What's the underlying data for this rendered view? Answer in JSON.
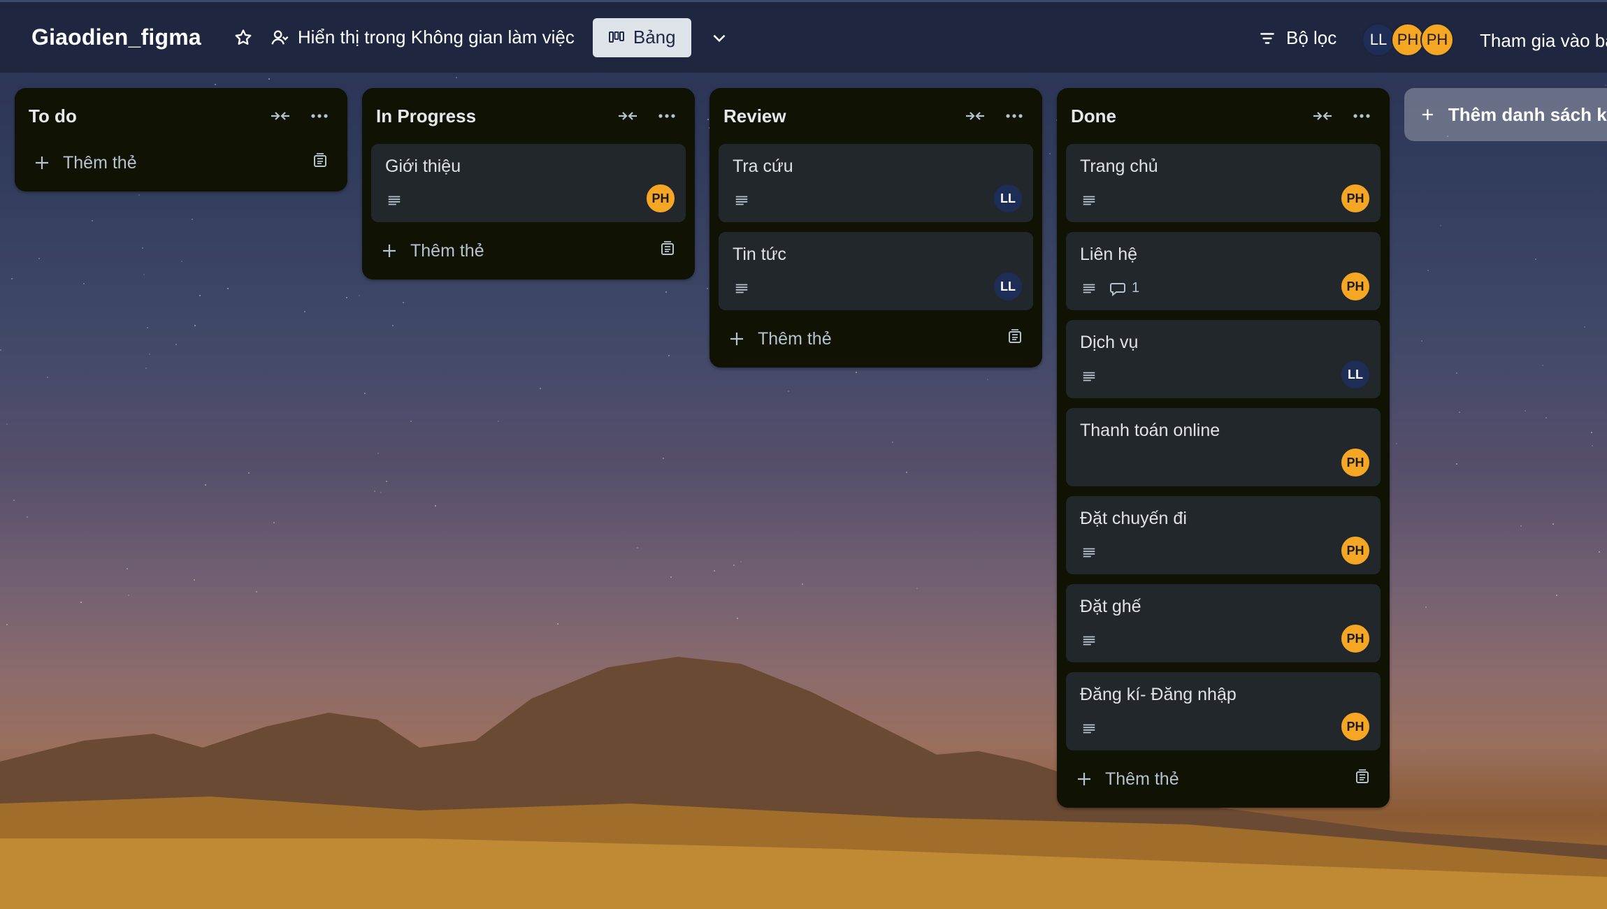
{
  "board": {
    "title": "Giaodien_figma",
    "visibility_label": "Hiển thị trong Không gian làm việc",
    "view_label": "Bảng",
    "filter_label": "Bộ lọc",
    "join_label": "Tham gia vào bả",
    "members": [
      "LL",
      "PH",
      "PH"
    ]
  },
  "colors": {
    "list_bg": "#101204",
    "card_bg": "#22272b",
    "avatar_ph": "#f5a623",
    "avatar_ll": "#1d2d55"
  },
  "icons": {
    "star": "star-icon",
    "visibility": "people-icon",
    "view": "board-icon",
    "chevron": "chevron-down-icon",
    "filter": "filter-icon",
    "collapse": "collapse-arrows-icon",
    "more": "more-dots-icon",
    "description": "description-lines-icon",
    "comment": "comment-icon",
    "template": "template-icon",
    "plus": "plus-icon"
  },
  "add_card_label": "Thêm thẻ",
  "add_list_label": "Thêm danh sách khá",
  "lists": [
    {
      "title": "To do",
      "cards": []
    },
    {
      "title": "In Progress",
      "cards": [
        {
          "title": "Giới thiệu",
          "has_description": true,
          "comments": "",
          "member": "PH"
        }
      ]
    },
    {
      "title": "Review",
      "cards": [
        {
          "title": "Tra cứu",
          "has_description": true,
          "comments": "",
          "member": "LL"
        },
        {
          "title": "Tin tức",
          "has_description": true,
          "comments": "",
          "member": "LL"
        }
      ]
    },
    {
      "title": "Done",
      "cards": [
        {
          "title": "Trang chủ",
          "has_description": true,
          "comments": "",
          "member": "PH"
        },
        {
          "title": "Liên hệ",
          "has_description": true,
          "comments": "1",
          "member": "PH"
        },
        {
          "title": "Dịch vụ",
          "has_description": true,
          "comments": "",
          "member": "LL"
        },
        {
          "title": "Thanh toán online",
          "has_description": false,
          "comments": "",
          "member": "PH"
        },
        {
          "title": "Đặt chuyến đi",
          "has_description": true,
          "comments": "",
          "member": "PH"
        },
        {
          "title": "Đặt ghế",
          "has_description": true,
          "comments": "",
          "member": "PH"
        },
        {
          "title": "Đăng kí- Đăng nhập",
          "has_description": true,
          "comments": "",
          "member": "PH"
        }
      ]
    }
  ]
}
